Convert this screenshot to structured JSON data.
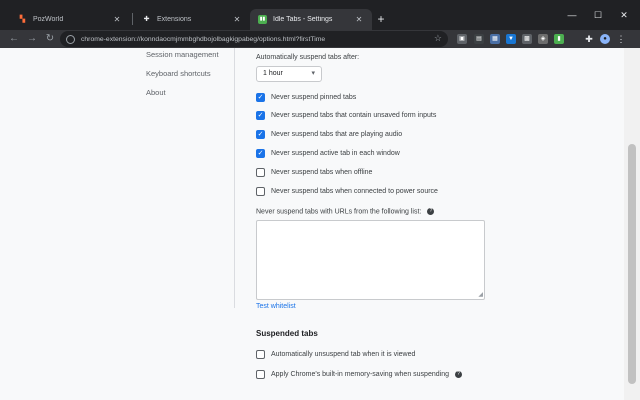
{
  "tabs": [
    {
      "title": "PozWorld",
      "icon": "pozworld-icon",
      "close": "✕"
    },
    {
      "title": "Extensions",
      "icon": "puzzle-icon",
      "close": "✕"
    },
    {
      "title": "Idle Tabs - Settings",
      "icon": "idle-tabs-icon",
      "close": "✕"
    }
  ],
  "new_tab": "+",
  "window_controls": {
    "minimize": "—",
    "maximize": "☐",
    "close": "✕"
  },
  "toolbar": {
    "url": "chrome-extension://konndaocmjmmbghdbojolbagkigpabeg/options.html?firstTime",
    "back": "←",
    "forward": "→",
    "reload": "↻"
  },
  "sidebar": {
    "items": [
      "Session management",
      "Keyboard shortcuts",
      "About"
    ]
  },
  "settings": {
    "suspend_after_label": "Automatically suspend tabs after:",
    "suspend_after_value": "1 hour",
    "checkboxes": [
      {
        "label": "Never suspend pinned tabs",
        "checked": true
      },
      {
        "label": "Never suspend tabs that contain unsaved form inputs",
        "checked": true
      },
      {
        "label": "Never suspend tabs that are playing audio",
        "checked": true
      },
      {
        "label": "Never suspend active tab in each window",
        "checked": true
      },
      {
        "label": "Never suspend tabs when offline",
        "checked": false
      },
      {
        "label": "Never suspend tabs when connected to power source",
        "checked": false
      }
    ],
    "whitelist_label": "Never suspend tabs with URLs from the following list:",
    "whitelist_value": "",
    "test_whitelist_link": "Test whitelist",
    "suspended_tabs_title": "Suspended tabs",
    "suspended_checkboxes": [
      {
        "label": "Automatically unsuspend tab when it is viewed",
        "checked": false
      },
      {
        "label": "Apply Chrome's built-in memory-saving when suspending",
        "checked": false
      }
    ],
    "check_glyph": "✓",
    "help_glyph": "?"
  },
  "colors": {
    "accent": "#1a73e8",
    "frame": "#202124",
    "toolbar": "#35363a"
  }
}
